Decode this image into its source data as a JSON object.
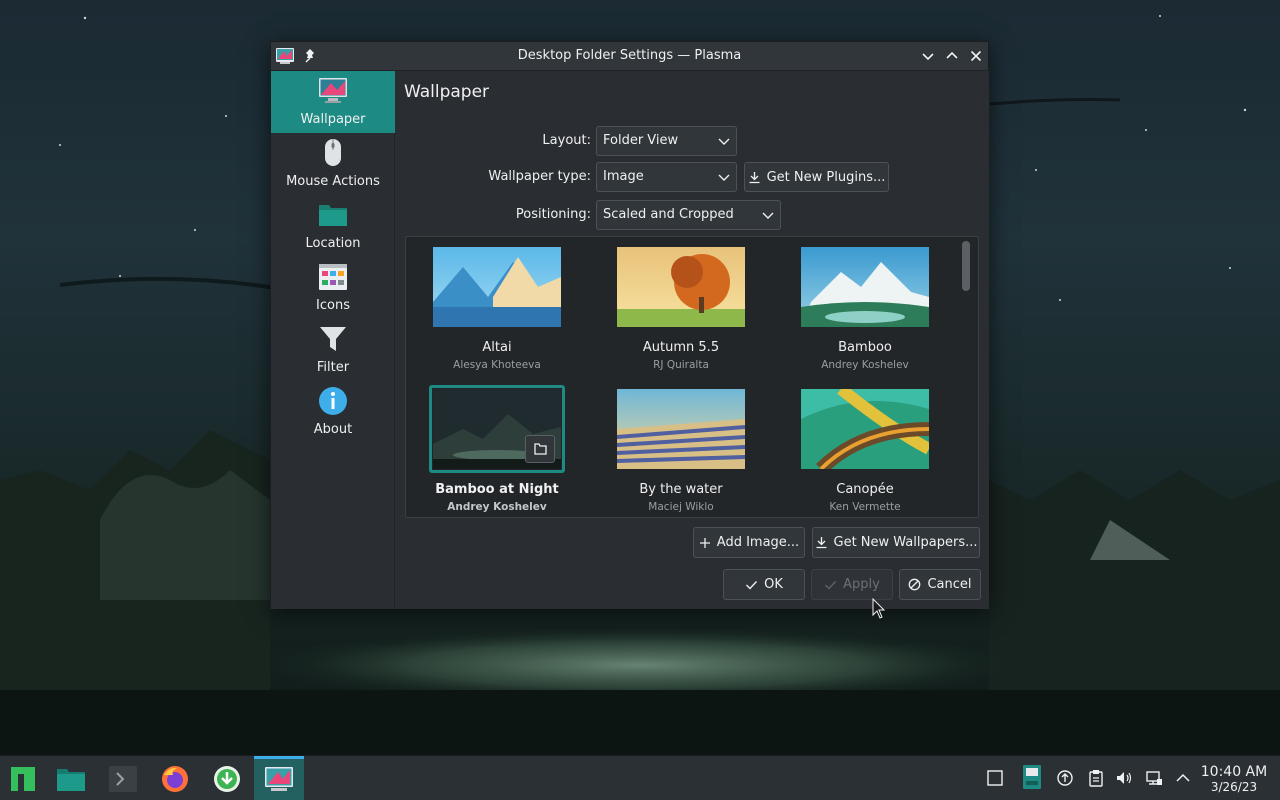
{
  "window": {
    "title": "Desktop Folder Settings — Plasma"
  },
  "sidebar": {
    "items": [
      {
        "label": "Wallpaper",
        "icon": "monitor-icon",
        "active": true
      },
      {
        "label": "Mouse Actions",
        "icon": "mouse-icon",
        "active": false
      },
      {
        "label": "Location",
        "icon": "folder-icon",
        "active": false
      },
      {
        "label": "Icons",
        "icon": "icons-grid-icon",
        "active": false
      },
      {
        "label": "Filter",
        "icon": "filter-icon",
        "active": false
      },
      {
        "label": "About",
        "icon": "info-icon",
        "active": false
      }
    ]
  },
  "main": {
    "page_title": "Wallpaper",
    "layout_label": "Layout:",
    "layout_value": "Folder View",
    "wallpaper_type_label": "Wallpaper type:",
    "wallpaper_type_value": "Image",
    "get_new_plugins": "Get New Plugins...",
    "positioning_label": "Positioning:",
    "positioning_value": "Scaled and Cropped",
    "wallpapers": [
      {
        "name": "Altai",
        "author": "Alesya Khoteeva",
        "selected": false
      },
      {
        "name": "Autumn 5.5",
        "author": "RJ Quiralta",
        "selected": false
      },
      {
        "name": "Bamboo",
        "author": "Andrey Koshelev",
        "selected": false
      },
      {
        "name": "Bamboo at Night",
        "author": "Andrey Koshelev",
        "selected": true
      },
      {
        "name": "By the water",
        "author": "Maciej Wiklo",
        "selected": false
      },
      {
        "name": "Canopée",
        "author": "Ken Vermette",
        "selected": false
      }
    ],
    "add_image": "Add Image...",
    "get_new_wallpapers": "Get New Wallpapers...",
    "ok": "OK",
    "apply": "Apply",
    "cancel": "Cancel"
  },
  "taskbar": {
    "apps": [
      "manjaro-menu-icon",
      "file-manager-icon",
      "terminal-icon",
      "firefox-icon",
      "download-manager-icon",
      "plasma-settings-icon"
    ],
    "tray": [
      "show-desktop-icon",
      "updates-icon",
      "clipboard-icon",
      "volume-icon",
      "network-icon",
      "tray-expand-icon"
    ],
    "time": "10:40 AM",
    "date": "3/26/23"
  },
  "colors": {
    "accent": "#1d8b83",
    "window_bg": "#2a2e32",
    "titlebar": "#31363b",
    "text": "#eff0f1"
  }
}
